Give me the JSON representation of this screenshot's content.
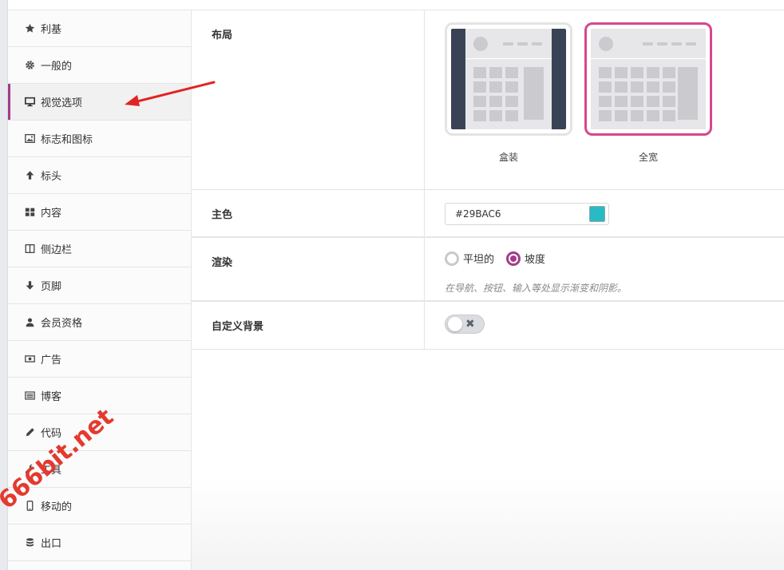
{
  "sidebar": {
    "items": [
      {
        "label": "利基",
        "icon": "star-icon"
      },
      {
        "label": "一般的",
        "icon": "gear-icon"
      },
      {
        "label": "视觉选项",
        "icon": "monitor-icon",
        "active": true
      },
      {
        "label": "标志和图标",
        "icon": "image-icon"
      },
      {
        "label": "标头",
        "icon": "arrow-up-icon"
      },
      {
        "label": "内容",
        "icon": "grid-icon"
      },
      {
        "label": "侧边栏",
        "icon": "columns-icon"
      },
      {
        "label": "页脚",
        "icon": "arrow-down-icon"
      },
      {
        "label": "会员资格",
        "icon": "user-icon"
      },
      {
        "label": "广告",
        "icon": "money-icon"
      },
      {
        "label": "博客",
        "icon": "list-icon"
      },
      {
        "label": "代码",
        "icon": "pencil-icon"
      },
      {
        "label": "工具",
        "icon": "wrench-icon"
      },
      {
        "label": "移动的",
        "icon": "mobile-icon"
      },
      {
        "label": "出口",
        "icon": "database-icon"
      }
    ]
  },
  "settings": {
    "layout": {
      "label": "布局",
      "options": [
        {
          "caption": "盒装",
          "selected": false
        },
        {
          "caption": "全宽",
          "selected": true
        }
      ]
    },
    "primary_color": {
      "label": "主色",
      "value": "#29BAC6",
      "swatch": "#29BAC6"
    },
    "render": {
      "label": "渲染",
      "options": [
        {
          "label": "平坦的",
          "checked": false
        },
        {
          "label": "坡度",
          "checked": true
        }
      ],
      "description": "在导航、按钮、输入等处显示渐变和阴影。"
    },
    "custom_background": {
      "label": "自定义背景",
      "enabled": false
    }
  },
  "colors": {
    "accent": "#a23d8a",
    "selected_border": "#d7468f",
    "annotation_arrow": "#e02424"
  },
  "watermark": "666bit.net"
}
